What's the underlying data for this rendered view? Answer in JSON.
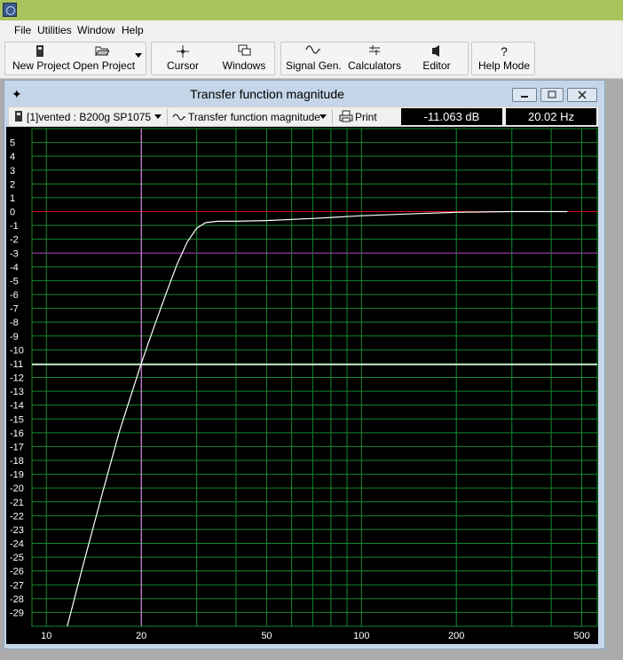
{
  "menu": [
    "File",
    "Utilities",
    "Window",
    "Help"
  ],
  "toolbar": {
    "new_project": "New Project",
    "open_project": "Open Project",
    "cursor": "Cursor",
    "windows": "Windows",
    "signal_gen": "Signal Gen.",
    "calculators": "Calculators",
    "editor": "Editor",
    "help_mode": "Help Mode",
    "help_icon": "?"
  },
  "window": {
    "title": "Transfer function magnitude",
    "project_select": "[1]vented : B200g SP1075",
    "view_select": "Transfer function magnitude",
    "print": "Print",
    "cursor_db": "-11.063 dB",
    "cursor_hz": "20.02 Hz"
  },
  "colors": {
    "plot_bg": "#000000",
    "grid": "#138a2c",
    "curve": "#ffffff",
    "zero_line": "#cc1010",
    "minus3_line": "#b020b0",
    "cursor_vertical": "#ff88ff",
    "cursor_horizontal": "#ffffff"
  },
  "chart_data": {
    "type": "line",
    "x_scale": "log",
    "xlim": [
      9,
      560
    ],
    "ylim": [
      -30,
      6
    ],
    "x_ticks": [
      10,
      20,
      50,
      100,
      200,
      500
    ],
    "y_ticks": [
      5,
      4,
      3,
      2,
      1,
      0,
      -1,
      -2,
      -3,
      -4,
      -5,
      -6,
      -7,
      -8,
      -9,
      -10,
      -11,
      -12,
      -13,
      -14,
      -15,
      -16,
      -17,
      -18,
      -19,
      -20,
      -21,
      -22,
      -23,
      -24,
      -25,
      -26,
      -27,
      -28,
      -29
    ],
    "grid": true,
    "reference_lines": {
      "zero_db": 0,
      "minus3_db": -3
    },
    "cursor": {
      "x": 20.02,
      "y": -11.063
    },
    "series": [
      {
        "x": [
          11.5,
          13,
          15,
          17,
          20,
          22,
          24,
          26,
          28,
          30,
          32,
          35,
          40,
          50,
          70,
          100,
          150,
          200,
          300,
          450
        ],
        "values": [
          -30.5,
          -25.8,
          -20.5,
          -16,
          -11,
          -8.3,
          -5.9,
          -3.8,
          -2.2,
          -1.2,
          -0.8,
          -0.7,
          -0.7,
          -0.65,
          -0.5,
          -0.3,
          -0.15,
          -0.05,
          0.0,
          0.0
        ]
      }
    ]
  }
}
